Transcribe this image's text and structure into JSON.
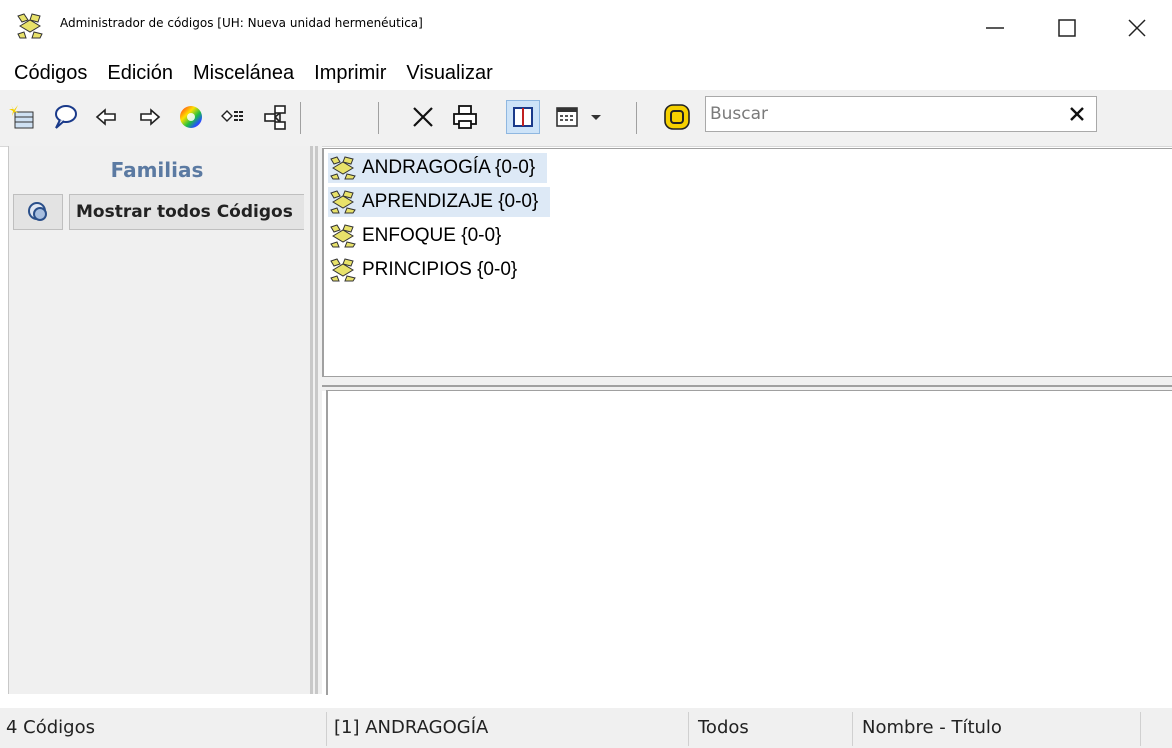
{
  "window": {
    "title": "Administrador de códigos [UH: Nueva unidad hermenéutica]",
    "icon": "code-manager-icon",
    "controls": [
      "minimize-icon",
      "maximize-icon",
      "close-icon"
    ]
  },
  "menu": {
    "items": [
      "Códigos",
      "Edición",
      "Miscelánea",
      "Imprimir",
      "Visualizar"
    ]
  },
  "toolbar": {
    "icons": [
      "new-code-icon",
      "comment-icon",
      "back-arrow-icon",
      "forward-arrow-icon",
      "color-wheel-icon",
      "code-filter-icon",
      "network-icon",
      "delete-icon",
      "print-icon",
      "split-view-icon",
      "calendar-view-icon",
      "dropdown-arrow-icon",
      "code-mode-icon",
      "clear-icon"
    ],
    "search": {
      "value": "",
      "placeholder": "Buscar"
    }
  },
  "families": {
    "title": "Familias",
    "show_all_label": "Mostrar todos Códigos"
  },
  "codes": [
    {
      "label": "ANDRAGOGÍA {0-0}",
      "selected": true
    },
    {
      "label": "APRENDIZAJE {0-0}",
      "selected": true
    },
    {
      "label": "ENFOQUE {0-0}",
      "selected": false
    },
    {
      "label": "PRINCIPIOS {0-0}",
      "selected": false
    }
  ],
  "status": {
    "count": "4 Códigos",
    "current": "[1] ANDRAGOGÍA",
    "filter": "Todos",
    "sort": "Nombre - Título"
  },
  "colors": {
    "accent": "#5b7aa2",
    "selection": "#dde9f6",
    "code_icon_fill": "#e8e26a"
  }
}
